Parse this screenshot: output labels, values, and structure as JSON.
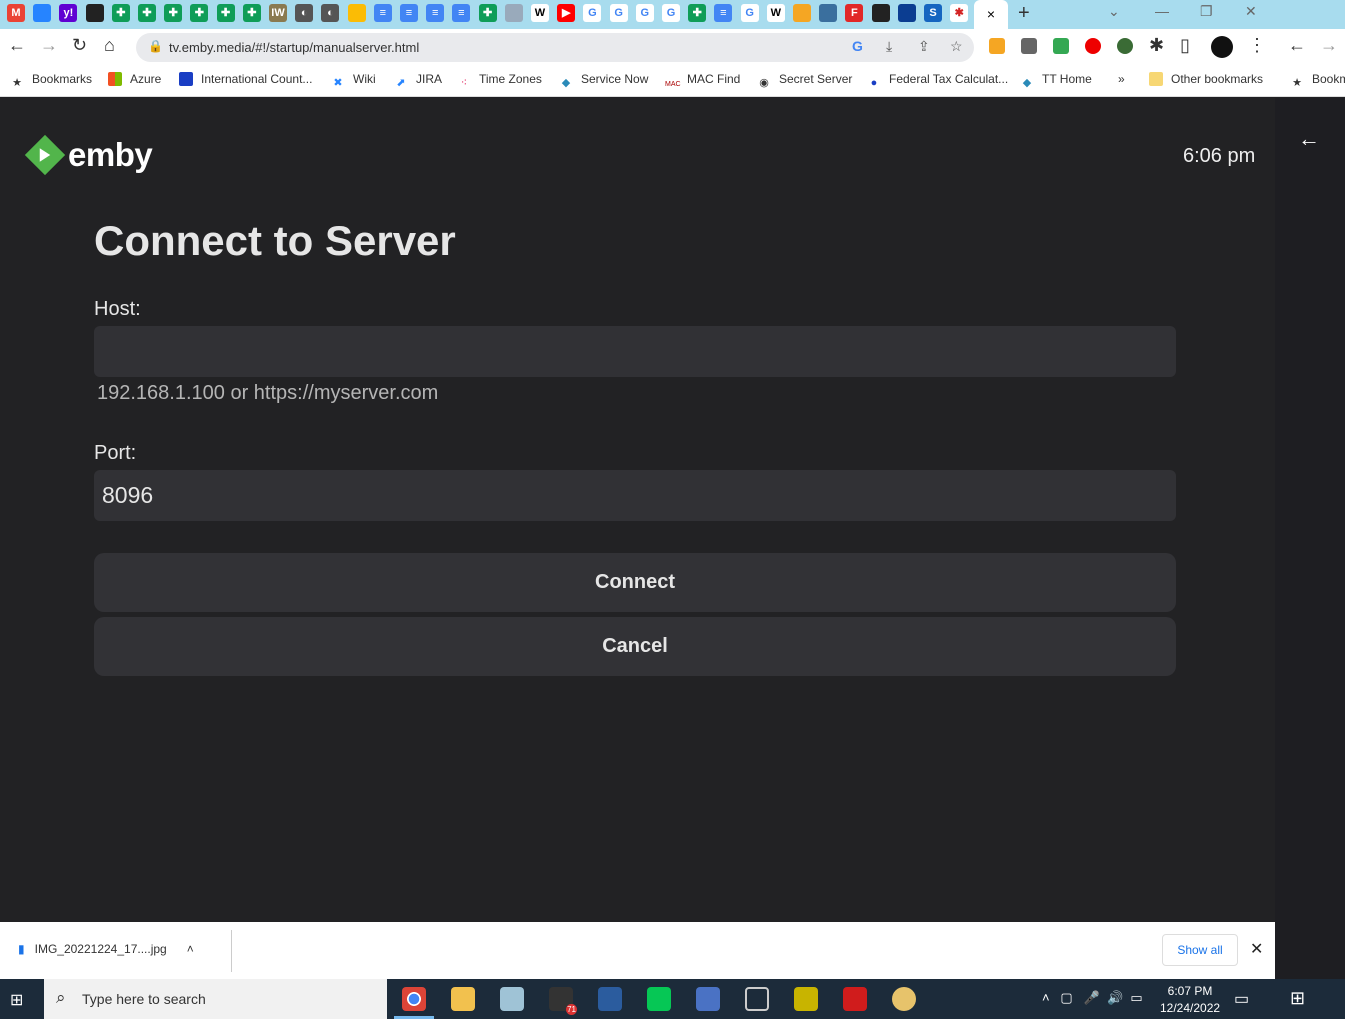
{
  "browser": {
    "tab_icons": [
      "gmail",
      "jira",
      "yahoo",
      "app",
      "sheets",
      "sheets",
      "sheets",
      "sheets",
      "sheets",
      "sheets",
      "iw",
      "globe",
      "globe",
      "photos",
      "docs",
      "docs",
      "docs",
      "docs",
      "sheets",
      "gg",
      "wikipedia",
      "youtube",
      "google",
      "google",
      "google",
      "google",
      "sheets",
      "docs",
      "google",
      "wikipedia",
      "folder",
      "chart",
      "flipboard",
      "app",
      "nasa",
      "s",
      "yelp"
    ],
    "active_tab_close": "×",
    "new_tab": "+",
    "url": "tv.emby.media/#!/startup/manualserver.html",
    "bookmarks": [
      {
        "label": "Bookmarks",
        "icon": "star-icon"
      },
      {
        "label": "Azure",
        "icon": "windows-icon"
      },
      {
        "label": "International Count...",
        "icon": "doc-icon"
      },
      {
        "label": "Wiki",
        "icon": "confluence-icon"
      },
      {
        "label": "JIRA",
        "icon": "jira-icon"
      },
      {
        "label": "Time Zones",
        "icon": "slack-icon"
      },
      {
        "label": "Service Now",
        "icon": "diamond-icon"
      },
      {
        "label": "MAC Find",
        "icon": "mac-find-icon"
      },
      {
        "label": "Secret Server",
        "icon": "lock-icon"
      },
      {
        "label": "Federal Tax Calculat...",
        "icon": "flag-icon"
      },
      {
        "label": "TT Home",
        "icon": "diamond-icon"
      }
    ],
    "overflow": "»",
    "other_bookmarks": "Other bookmarks",
    "mobile_bookmarks": "Bookm"
  },
  "app": {
    "logo": "emby",
    "clock": "6:06 pm",
    "title": "Connect to Server",
    "host_label": "Host:",
    "host_value": "",
    "host_hint": "192.168.1.100 or https://myserver.com",
    "port_label": "Port:",
    "port_value": "8096",
    "connect": "Connect",
    "cancel": "Cancel"
  },
  "download": {
    "file": "IMG_20221224_17....jpg",
    "show_all": "Show all"
  },
  "taskbar": {
    "search_placeholder": "Type here to search",
    "time": "6:07 PM",
    "date": "12/24/2022",
    "badge": "71"
  },
  "colors": {
    "emby_green": "#52b54b",
    "bg": "#222224",
    "field": "#313135"
  }
}
